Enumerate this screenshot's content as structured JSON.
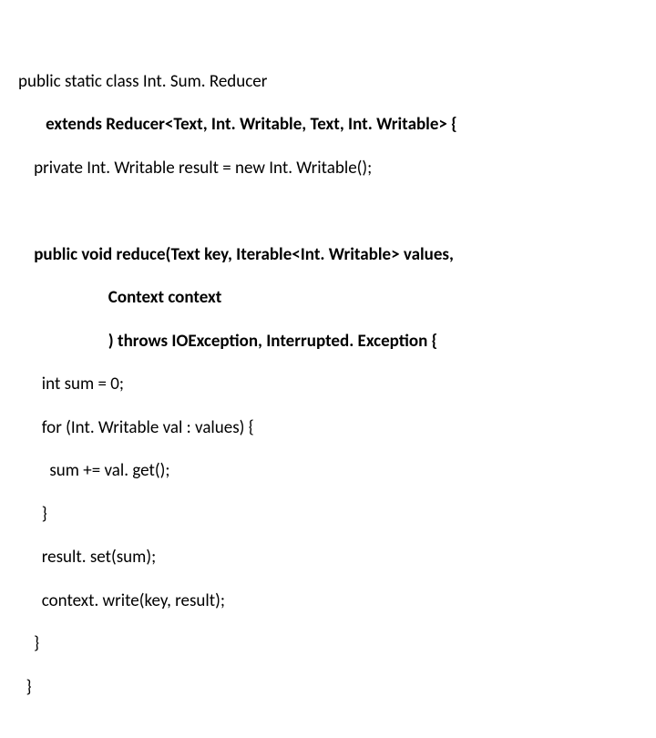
{
  "code": {
    "l1a": "public static class Int. Sum. Reducer",
    "l2a": "       ",
    "l2b": "extends Reducer<Text, Int. Writable, Text, Int. Writable> {",
    "l3a": "    private Int. Writable result = new Int. Writable();",
    "l4a": "",
    "l5a": "    ",
    "l5b": "public void reduce(Text key, Iterable<Int. Writable> values,",
    "l6a": "                       ",
    "l6b": "Context context",
    "l7a": "                       ",
    "l7b": ") throws IOException, Interrupted. Exception {",
    "l8a": "      int sum = 0;",
    "l9a": "      for (Int. Writable val : values) {",
    "l10a": "        sum += val. get();",
    "l11a": "      }",
    "l12a": "      result. set(sum);",
    "l13a": "      context. write(key, result);",
    "l14a": "    }",
    "l15a": "  }"
  }
}
